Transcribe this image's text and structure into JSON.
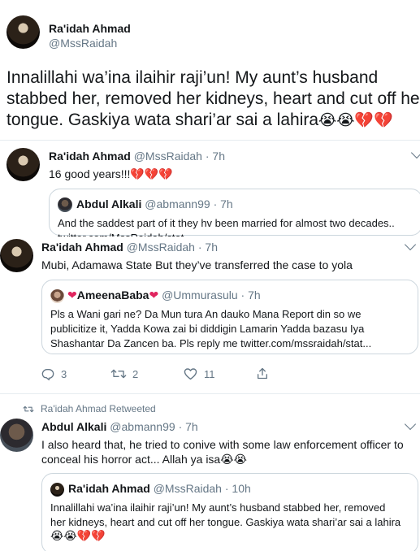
{
  "main_tweet": {
    "name": "Ra'idah Ahmad",
    "handle": "@MssRaidah",
    "line1": "Innalillahi wa’ina ilaihir raji’un! My aunt’s husband",
    "line2": "stabbed her, removed her kidneys, heart and cut off her",
    "line3": "tongue. Gaskiya wata shari’ar sai a lahira",
    "emojis": "😭😭💔💔"
  },
  "reply1": {
    "name": "Ra'idah Ahmad",
    "handle": "@MssRaidah",
    "time": "· 7h",
    "text": "16 good years!!!",
    "emojis": "💔💔💔",
    "quote": {
      "name": "Abdul Alkali",
      "handle": "@abmann99",
      "time": "· 7h",
      "text": "And the saddest part of it they hv been married for almost two decades..",
      "text2": "twitter.com/MssRaidah/stat..."
    }
  },
  "reply2": {
    "name": "Ra'idah Ahmad",
    "handle": "@MssRaidah",
    "time": "· 7h",
    "text": "Mubi, Adamawa State But they’ve transferred the case to yola",
    "quote": {
      "name": "AmeenaBaba",
      "handle": "@Ummurasulu",
      "time": "· 7h",
      "line1": "Pls a Wani gari ne? Da Mun tura An dauko Mana Report din so we",
      "line2": "publicitize it, Yadda Kowa zai bi diddigin Lamarin Yadda bazasu Iya",
      "line3": "Shashantar Da Zancen ba. Pls reply me twitter.com/mssraidah/stat..."
    },
    "actions": {
      "replies": "3",
      "retweets": "2",
      "likes": "11"
    }
  },
  "retweet": {
    "context": "Ra'idah Ahmad Retweeted",
    "name": "Abdul Alkali",
    "handle": "@abmann99",
    "time": "· 7h",
    "line1": "I also heard that, he tried to conive with some law enforcement officer to",
    "line2": "conceal his horror act... Allah ya isa",
    "emojis": "😭😭",
    "quote": {
      "name": "Ra'idah Ahmad",
      "handle": "@MssRaidah",
      "time": "· 10h",
      "line1": "Innalillahi wa’ina ilaihir raji’un! My aunt’s husband stabbed her, removed",
      "line2": "her kidneys, heart and cut off her tongue. Gaskiya wata shari’ar sai a lahira",
      "emojis": "😭😭💔💔"
    }
  },
  "colors": {
    "text": "#14171a",
    "secondary": "#657786",
    "border": "#ccd6dd",
    "heart": "#e0245e"
  }
}
